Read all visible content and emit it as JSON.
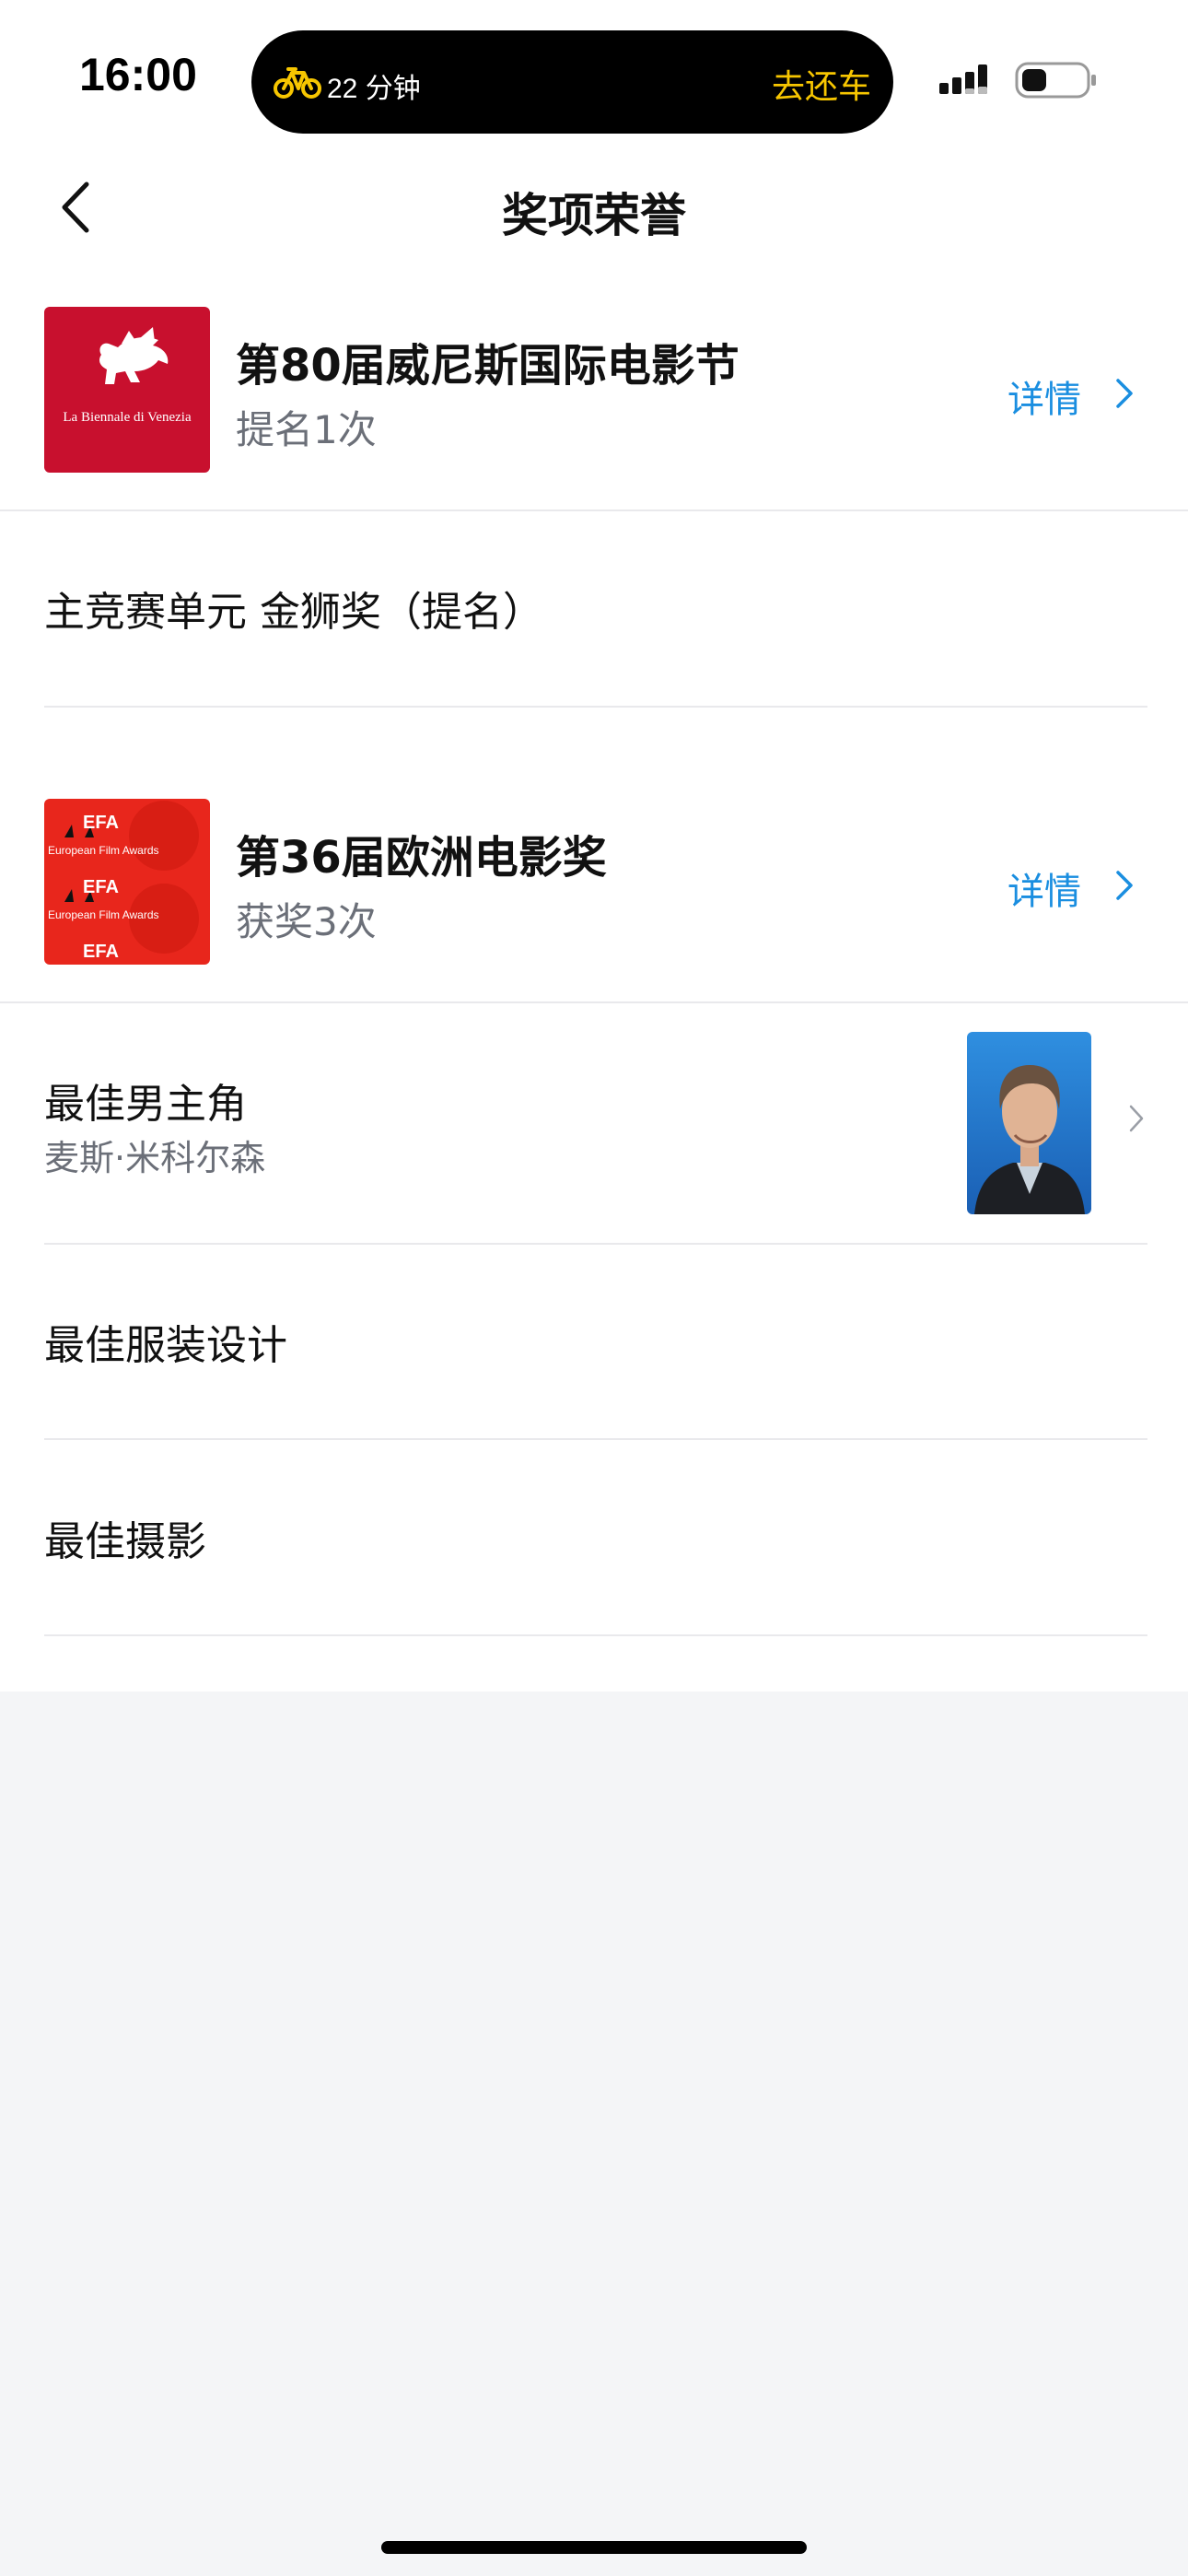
{
  "status_bar": {
    "time": "16:00",
    "island_text": "22 分钟",
    "island_action": "去还车",
    "accent_color": "#f7c600"
  },
  "nav": {
    "title": "奖项荣誉",
    "back_icon": "chevron-left-icon"
  },
  "awards": [
    {
      "name": "第80届威尼斯国际电影节",
      "count": "提名1次",
      "detail_label": "详情",
      "logo_text": "La Biennale di Venezia",
      "logo_color": "#c8102e",
      "categories": [
        {
          "label": "主竞赛单元 金狮奖（提名）"
        }
      ]
    },
    {
      "name": "第36届欧洲电影奖",
      "count": "获奖3次",
      "detail_label": "详情",
      "logo_text": "European Film Awards",
      "logo_color": "#e8261c",
      "categories": [
        {
          "label": "最佳男主角",
          "winner": "麦斯·米科尔森"
        },
        {
          "label": "最佳服装设计"
        },
        {
          "label": "最佳摄影"
        }
      ]
    }
  ],
  "colors": {
    "link": "#1a8ee0",
    "secondary_text": "#6b6f78",
    "background": "#f4f5f7"
  }
}
